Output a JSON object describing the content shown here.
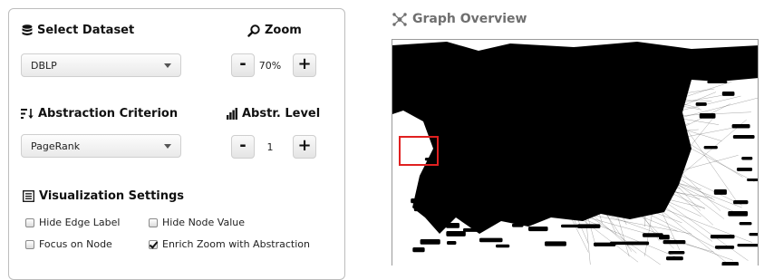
{
  "dataset": {
    "title": "Select Dataset",
    "selected": "DBLP"
  },
  "zoom": {
    "title": "Zoom",
    "value": "70%",
    "minus": "-",
    "plus": "+"
  },
  "abstraction": {
    "title": "Abstraction Criterion",
    "selected": "PageRank"
  },
  "level": {
    "title": "Abstr. Level",
    "value": "1",
    "minus": "-",
    "plus": "+"
  },
  "visualization": {
    "title": "Visualization Settings",
    "options": [
      {
        "label": "Hide Edge Label",
        "checked": false
      },
      {
        "label": "Hide Node Value",
        "checked": false
      },
      {
        "label": "Focus on Node",
        "checked": false
      },
      {
        "label": "Enrich Zoom with Abstraction",
        "checked": true
      }
    ]
  },
  "graph": {
    "title": "Graph Overview",
    "focus_color": "#e02020"
  },
  "icons": {
    "dataset": "database-icon",
    "zoom": "magnifier-icon",
    "abstraction": "sort-icon",
    "level": "bar-chart-icon",
    "visualization": "settings-list-icon",
    "graph": "network-icon"
  }
}
